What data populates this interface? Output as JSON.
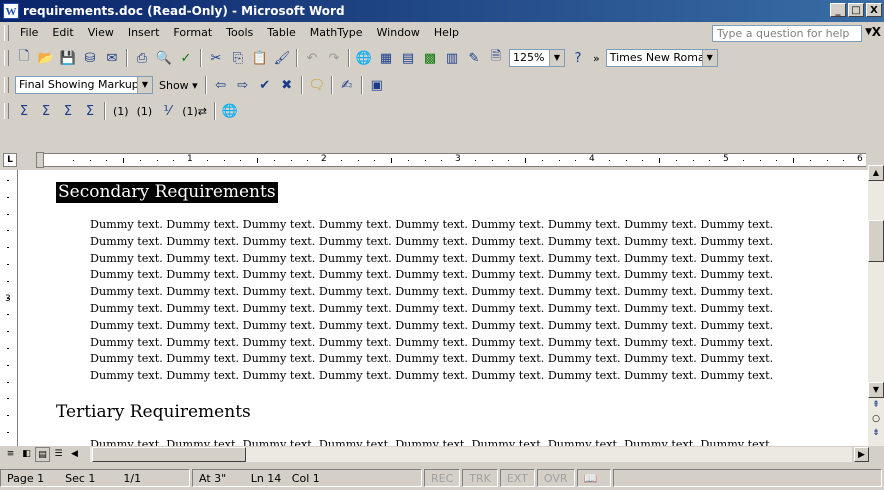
{
  "window": {
    "title": "requirements.doc (Read-Only) - Microsoft Word",
    "app_icon": "W",
    "controls": [
      "_",
      "□",
      "X"
    ]
  },
  "menu": {
    "items": [
      "File",
      "Edit",
      "View",
      "Insert",
      "Format",
      "Tools",
      "Table",
      "MathType",
      "Window",
      "Help"
    ],
    "help_placeholder": "Type a question for help",
    "close_glyph": "X"
  },
  "standard_toolbar": {
    "zoom": "125%",
    "font": "Times New Roman",
    "more_glyph": "»"
  },
  "reviewing_toolbar": {
    "display_mode": "Final Showing Markup",
    "show_label": "Show"
  },
  "mathtype_toolbar": {
    "labels": [
      "(1)",
      "(1)",
      "(1)⇄"
    ]
  },
  "ruler": {
    "numbers": [
      "1",
      "2",
      "3",
      "4",
      "5",
      "6"
    ],
    "corner": "L"
  },
  "vertical_ruler": {
    "numbers": [
      "3"
    ]
  },
  "document": {
    "heading1": "Secondary Requirements",
    "body_line": "Dummy text. Dummy text. Dummy text. Dummy text. Dummy text. Dummy text. Dummy text. Dummy text. Dummy text.",
    "heading2": "Tertiary Requirements"
  },
  "status": {
    "page": "Page 1",
    "sec": "Sec 1",
    "pages": "1/1",
    "at": "At 3\"",
    "ln": "Ln 14",
    "col": "Col 1",
    "rec": "REC",
    "trk": "TRK",
    "ext": "EXT",
    "ovr": "OVR"
  },
  "colors": {
    "title_gradient_start": "#0a246a",
    "title_gradient_end": "#3a6ea5",
    "chrome": "#d4d0c8"
  }
}
